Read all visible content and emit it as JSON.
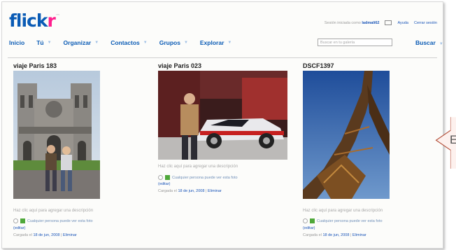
{
  "logo": {
    "part1": "flick",
    "part2": "r",
    "tm": "™"
  },
  "topbar": {
    "signed_in_prefix": "Sesión iniciada como",
    "username": "ladmali62",
    "help": "Ayuda",
    "logout": "Cerrar sesión"
  },
  "nav": {
    "items": [
      {
        "label": "Inicio",
        "has_arrow": false
      },
      {
        "label": "Tú",
        "has_arrow": true
      },
      {
        "label": "Organizar",
        "has_arrow": true
      },
      {
        "label": "Contactos",
        "has_arrow": true
      },
      {
        "label": "Grupos",
        "has_arrow": true
      },
      {
        "label": "Explorar",
        "has_arrow": true
      }
    ]
  },
  "search": {
    "placeholder": "Buscar en tu galería",
    "button": "Buscar"
  },
  "photos": [
    {
      "title": "viaje Paris 183",
      "description_prompt": "Haz clic aquí para agregar una descripción",
      "permission": "Cualquier persona puede ver esta foto",
      "edit_link": "(editar)",
      "uploaded_prefix": "Cargada el",
      "uploaded_date": "18 de jun, 2008",
      "separator": "|",
      "delete": "Eliminar"
    },
    {
      "title": "viaje Paris 023",
      "description_prompt": "Haz clic aquí para agregar una descripción",
      "permission": "Cualquier persona puede ver esta foto",
      "edit_link": "(editar)",
      "uploaded_prefix": "Cargada el",
      "uploaded_date": "18 de jun, 2008",
      "separator": "|",
      "delete": "Eliminar"
    },
    {
      "title": "DSCF1397",
      "description_prompt": "Haz clic aquí para agregar una descripción",
      "permission": "Cualquier persona puede ver esta foto",
      "edit_link": "(editar)",
      "uploaded_prefix": "Cargada el",
      "uploaded_date": "18 de jun, 2008",
      "separator": "|",
      "delete": "Eliminar"
    }
  ],
  "callout": {
    "text": "E"
  },
  "colors": {
    "brand_blue": "#0a5bb5",
    "brand_pink": "#ff1f8e",
    "link_blue": "#1a55b8",
    "green": "#4fa83a"
  }
}
